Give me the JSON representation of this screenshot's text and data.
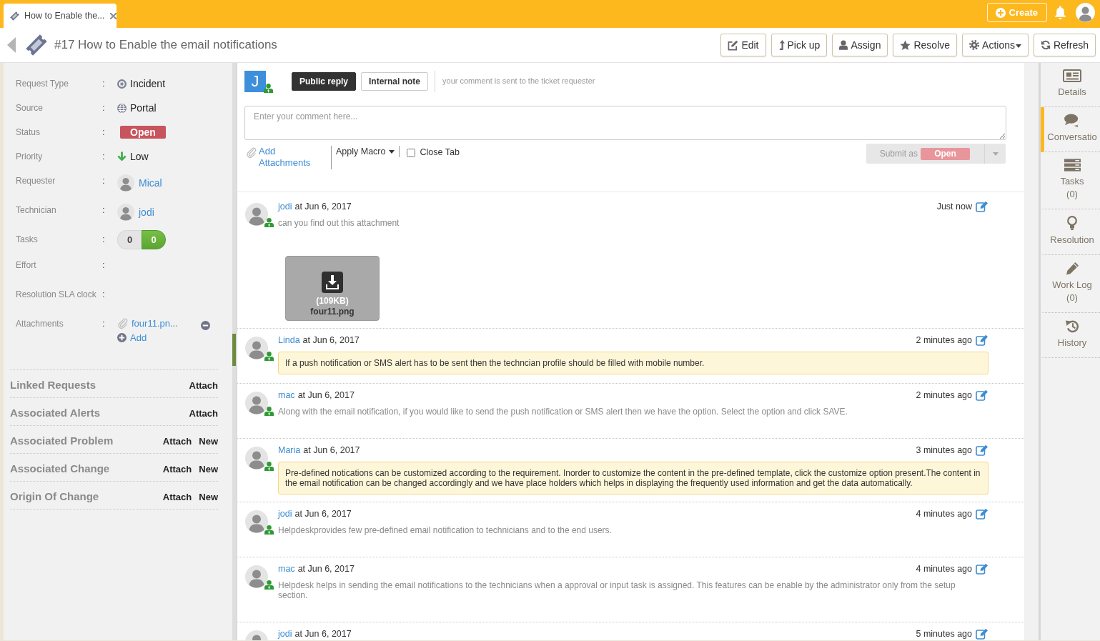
{
  "top_bar": {
    "tab": {
      "title": "How to Enable the..."
    },
    "create_button": "Create"
  },
  "header": {
    "title": "#17 How to Enable the email notifications",
    "buttons": [
      {
        "label": "Edit",
        "dropdown": false
      },
      {
        "label": "Pick up",
        "dropdown": false
      },
      {
        "label": "Assign",
        "dropdown": false
      },
      {
        "label": "Resolve",
        "dropdown": false
      },
      {
        "label": "Actions",
        "dropdown": true
      },
      {
        "label": "Refresh",
        "dropdown": false
      }
    ]
  },
  "details": {
    "fields": [
      {
        "label": "Request Type",
        "separator": ":",
        "kind": "category",
        "value": "Incident"
      },
      {
        "label": "Source",
        "separator": ":",
        "kind": "channel",
        "value": "Portal"
      },
      {
        "label": "Status",
        "separator": ":",
        "kind": "badge",
        "value": "Open"
      },
      {
        "label": "Priority",
        "separator": ":",
        "kind": "priority",
        "value": "Low"
      },
      {
        "label": "Requester",
        "separator": ":",
        "kind": "person",
        "value": "Mical"
      },
      {
        "label": "Technician",
        "separator": ":",
        "kind": "person",
        "value": "jodi"
      },
      {
        "label": "Tasks",
        "separator": ":",
        "kind": "counter",
        "counts": [
          "0",
          "0"
        ]
      },
      {
        "label": "Effort",
        "separator": ":",
        "kind": "blank"
      },
      {
        "label": "Resolution SLA clock",
        "separator": ":",
        "kind": "blank"
      },
      {
        "label": "Attachments",
        "separator": ":",
        "kind": "files",
        "files": [
          "four11.pn..."
        ],
        "add": "Add"
      }
    ],
    "sections": [
      {
        "title": "Linked Requests",
        "actions": [
          "Attach"
        ]
      },
      {
        "title": "Associated Alerts",
        "actions": [
          "Attach"
        ]
      },
      {
        "title": "Associated Problem",
        "actions": [
          "Attach",
          "New"
        ]
      },
      {
        "title": "Associated Change",
        "actions": [
          "Attach",
          "New"
        ]
      },
      {
        "title": "Origin Of Change",
        "actions": [
          "Attach",
          "New"
        ]
      }
    ]
  },
  "reply": {
    "avatar_letter": "J",
    "modes": [
      {
        "label": "Public reply",
        "selected": true
      },
      {
        "label": "Internal note",
        "selected": false
      }
    ],
    "hint": "your comment is sent to the ticket requester",
    "comment": {
      "placeholder": "Enter your comment here..."
    },
    "add_attachments": "Add Attachments",
    "apply_macro": "Apply Macro",
    "close_tab": {
      "label": "Close Tab",
      "checked": false
    },
    "submit": {
      "label": "Submit as",
      "status": "Open",
      "disabled": true
    }
  },
  "conversation": [
    {
      "author": "jodi",
      "date": "at Jun 6, 2017",
      "time": "Just now",
      "message": "can you find out this attachment",
      "highlighted": false,
      "attachment": {
        "size": "(109KB)",
        "name": "four11.png"
      }
    },
    {
      "author": "Linda",
      "date": "at Jun 6, 2017",
      "time": "2 minutes ago",
      "message": "If a push notification or SMS alert has to be sent then the techncian profile should be filled with mobile number.",
      "highlighted": true
    },
    {
      "author": "mac",
      "date": "at Jun 6, 2017",
      "time": "2 minutes ago",
      "message": "Along with the email notification, if you would like to send the push notification or SMS alert then we have the option. Select the option and click SAVE.",
      "highlighted": false
    },
    {
      "author": "Maria",
      "date": "at Jun 6, 2017",
      "time": "3 minutes ago",
      "message": "Pre-defined notications can be customized according to the requirement. Inorder to customize the content in the pre-defined template, click the customize option present.The content in the email notification can be changed accordingly and we have place holders which helps in displaying the frequently used information and get the data automatically.",
      "highlighted": true
    },
    {
      "author": "jodi",
      "date": "at Jun 6, 2017",
      "time": "4 minutes ago",
      "message": "Helpdeskprovides few pre-defined email notification to technicians and to the end users.",
      "highlighted": false
    },
    {
      "author": "mac",
      "date": "at Jun 6, 2017",
      "time": "4 minutes ago",
      "message": "Helpdesk helps in sending the email notifications to the technicians when a approval or input task is assigned. This features can be enable by the administrator only from the setup section.",
      "highlighted": false
    },
    {
      "author": "jodi",
      "date": "at Jun 6, 2017",
      "time": "5 minutes ago"
    }
  ],
  "sidebar": {
    "items": [
      {
        "label": "Details",
        "selected": false
      },
      {
        "label": "Conversatio",
        "selected": true
      },
      {
        "label": "Tasks",
        "count": "(0)",
        "selected": false
      },
      {
        "label": "Resolution",
        "selected": false
      },
      {
        "label": "Work Log",
        "count": "(0)",
        "selected": false
      },
      {
        "label": "History",
        "selected": false
      }
    ]
  }
}
